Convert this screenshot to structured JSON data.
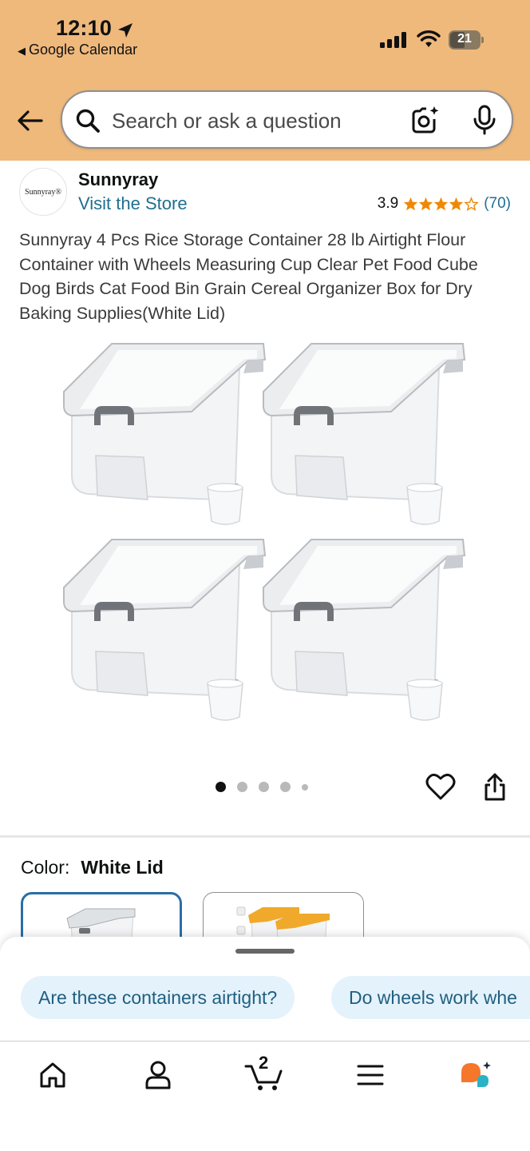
{
  "status_bar": {
    "time": "12:10",
    "back_app": "Google Calendar",
    "battery": "21"
  },
  "search": {
    "placeholder": "Search or ask a question"
  },
  "brand": {
    "logo_text": "Sunnyray®",
    "name": "Sunnyray",
    "visit_store": "Visit the Store"
  },
  "rating": {
    "value": "3.9",
    "stars": 3.9,
    "count": "(70)"
  },
  "product": {
    "title": "Sunnyray 4 Pcs Rice Storage Container 28 lb Airtight Flour Container with Wheels Measuring Cup Clear Pet Food Cube Dog Birds Cat Food Bin Grain Cereal Organizer Box for Dry Baking Supplies(White Lid)"
  },
  "gallery": {
    "image_count": 5,
    "current_index": 1
  },
  "color": {
    "label": "Color:",
    "value": "White Lid",
    "swatch_colors": [
      "#9aa0a6",
      "#f0a92a"
    ]
  },
  "suggestions": [
    "Are these containers airtight?",
    "Do wheels work whe"
  ],
  "tabbar": {
    "cart_count": "2",
    "tabs": [
      "home-icon",
      "account-icon",
      "cart-icon",
      "menu-icon",
      "rufus-icon"
    ]
  },
  "colors": {
    "header_bg": "#efb97c",
    "link": "#1f6f8f",
    "star": "#f08804",
    "chip_bg": "#e4f2fb",
    "swatch_selected": "#2a6ea6"
  }
}
